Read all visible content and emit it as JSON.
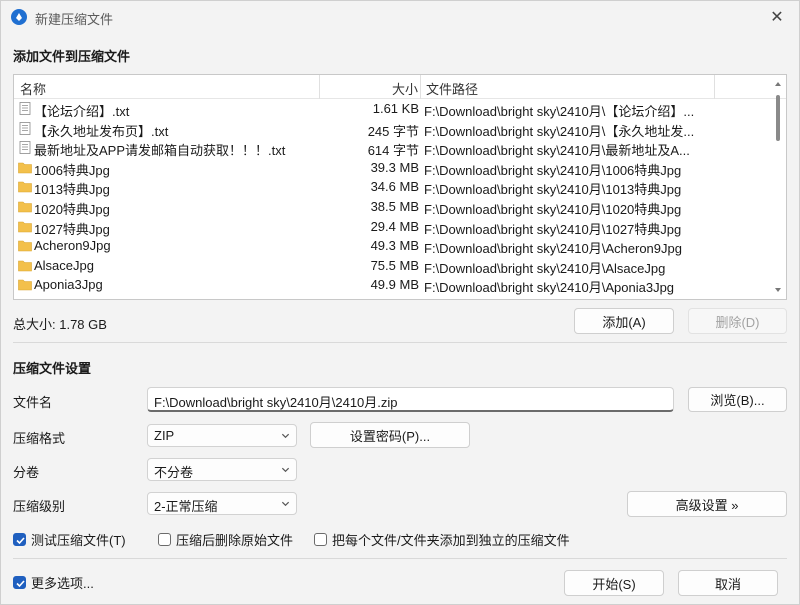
{
  "window": {
    "title": "新建压缩文件",
    "close_glyph": "✕"
  },
  "add_section": {
    "title": "添加文件到压缩文件",
    "columns": {
      "name": "名称",
      "size": "大小",
      "path": "文件路径"
    },
    "rows": [
      {
        "icon": "text-file-icon",
        "name": "【论坛介绍】.txt",
        "size": "1.61 KB",
        "path": "F:\\Download\\bright sky\\2410月\\【论坛介绍】..."
      },
      {
        "icon": "text-file-icon",
        "name": "【永久地址发布页】.txt",
        "size": "245 字节",
        "path": "F:\\Download\\bright sky\\2410月\\【永久地址发..."
      },
      {
        "icon": "text-file-icon",
        "name": "最新地址及APP请发邮箱自动获取！！！.txt",
        "size": "614 字节",
        "path": "F:\\Download\\bright sky\\2410月\\最新地址及A..."
      },
      {
        "icon": "folder-icon",
        "name": "1006特典Jpg",
        "size": "39.3 MB",
        "path": "F:\\Download\\bright sky\\2410月\\1006特典Jpg"
      },
      {
        "icon": "folder-icon",
        "name": "1013特典Jpg",
        "size": "34.6 MB",
        "path": "F:\\Download\\bright sky\\2410月\\1013特典Jpg"
      },
      {
        "icon": "folder-icon",
        "name": "1020特典Jpg",
        "size": "38.5 MB",
        "path": "F:\\Download\\bright sky\\2410月\\1020特典Jpg"
      },
      {
        "icon": "folder-icon",
        "name": "1027特典Jpg",
        "size": "29.4 MB",
        "path": "F:\\Download\\bright sky\\2410月\\1027特典Jpg"
      },
      {
        "icon": "folder-icon",
        "name": "Acheron9Jpg",
        "size": "49.3 MB",
        "path": "F:\\Download\\bright sky\\2410月\\Acheron9Jpg"
      },
      {
        "icon": "folder-icon",
        "name": "AlsaceJpg",
        "size": "75.5 MB",
        "path": "F:\\Download\\bright sky\\2410月\\AlsaceJpg"
      },
      {
        "icon": "folder-icon",
        "name": "Aponia3Jpg",
        "size": "49.9 MB",
        "path": "F:\\Download\\bright sky\\2410月\\Aponia3Jpg"
      }
    ],
    "total_label": "总大小: 1.78 GB",
    "add_button": "添加(A)",
    "delete_button": "删除(D)"
  },
  "settings": {
    "title": "压缩文件设置",
    "filename_label": "文件名",
    "filename_value": "F:\\Download\\bright sky\\2410月\\2410月.zip",
    "browse_button": "浏览(B)...",
    "format_label": "压缩格式",
    "format_value": "ZIP",
    "password_button": "设置密码(P)...",
    "split_label": "分卷",
    "split_value": "不分卷",
    "level_label": "压缩级别",
    "level_value": "2-正常压缩",
    "advanced_button": "高级设置 »",
    "test_checkbox": {
      "label": "测试压缩文件(T)",
      "checked": true
    },
    "delete_checkbox": {
      "label": "压缩后删除原始文件",
      "checked": false
    },
    "separate_checkbox": {
      "label": "把每个文件/文件夹添加到独立的压缩文件",
      "checked": false
    }
  },
  "footer": {
    "more_options": {
      "label": "更多选项...",
      "checked": true
    },
    "start_button": "开始(S)",
    "cancel_button": "取消"
  },
  "colors": {
    "accent": "#1f5fbf",
    "folder": "#f3c04b",
    "background": "#f3f3f3"
  }
}
